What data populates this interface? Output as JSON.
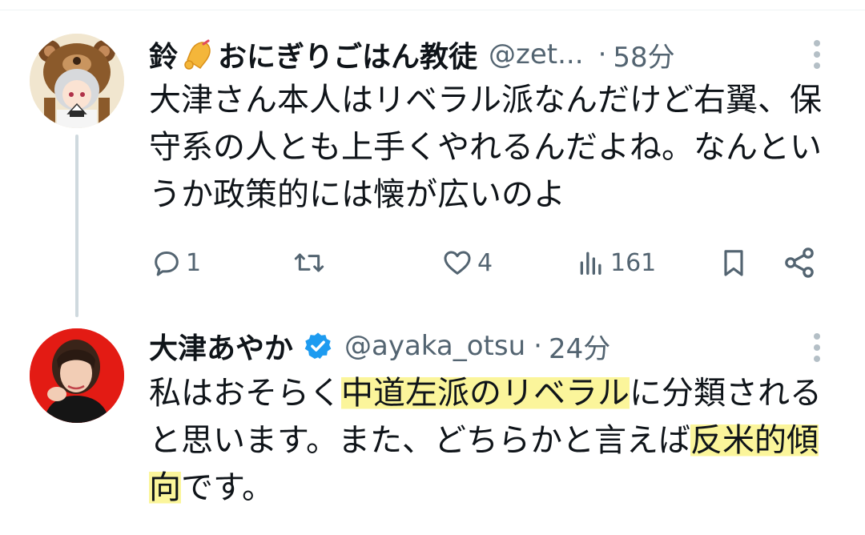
{
  "tweet1": {
    "name": "鈴",
    "name_rest": "おにぎりごはん教徒",
    "handle": "@zet...",
    "separator": "·",
    "time": "58分",
    "text": "大津さん本人はリベラル派なんだけど右翼、保守系の人とも上手くやれるんだよね。なんというか政策的には懐が広いのよ",
    "actions": {
      "reply_count": "1",
      "retweet_count": "",
      "like_count": "4",
      "view_count": "161"
    },
    "icons": [
      "bell-emoji-icon",
      "reply-icon",
      "retweet-icon",
      "like-icon",
      "views-icon",
      "bookmark-icon",
      "share-icon",
      "more-icon"
    ]
  },
  "tweet2": {
    "name": "大津あやか",
    "handle": "@ayaka_otsu",
    "separator": "·",
    "time": "24分",
    "text_part1": "私はおそらく",
    "highlight1": "中道左派のリベラル",
    "text_part2": "に分類されると思います。また、どちらかと言えば",
    "highlight2": "反米的傾向",
    "text_part3": "です。",
    "icons": [
      "verified-badge-icon",
      "more-icon"
    ]
  },
  "colors": {
    "text": "#0f1419",
    "secondary": "#536471",
    "thread_line": "#cfd9de",
    "verified": "#1d9bf0",
    "highlight": "#fbf59b"
  }
}
